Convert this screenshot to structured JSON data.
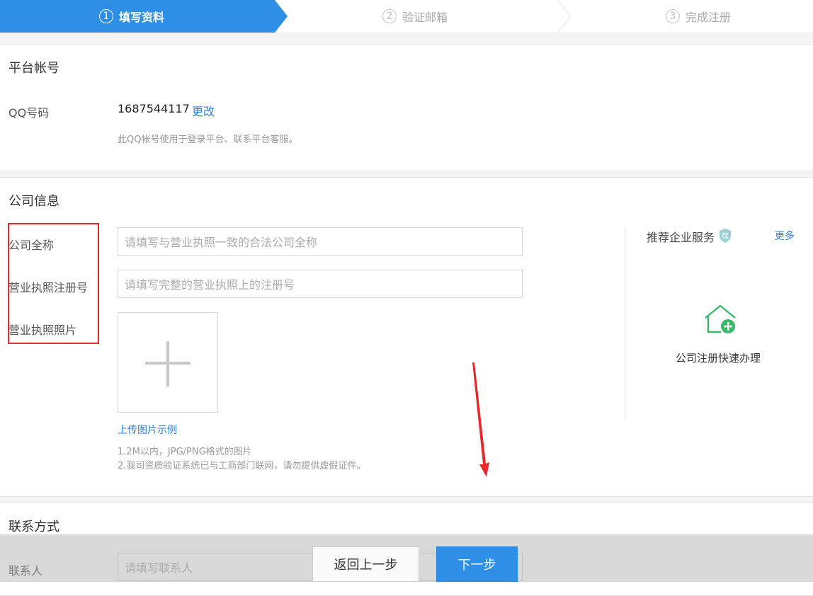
{
  "steps": [
    {
      "num": "1",
      "label": "填写资料",
      "active": true
    },
    {
      "num": "2",
      "label": "验证邮箱",
      "active": false
    },
    {
      "num": "3",
      "label": "完成注册",
      "active": false
    }
  ],
  "platform": {
    "title": "平台帐号",
    "qq_label": "QQ号码",
    "qq_value": "1687544117",
    "change_link": "更改",
    "qq_hint": "此QQ帐号使用于登录平台、联系平台客服。"
  },
  "company": {
    "title": "公司信息",
    "name_label": "公司全称",
    "name_placeholder": "请填写与营业执照一致的合法公司全称",
    "reg_label": "营业执照注册号",
    "reg_placeholder": "请填写完整的营业执照上的注册号",
    "photo_label": "营业执照照片",
    "upload_example": "上传图片示例",
    "hint1": "1.2M以内，JPG/PNG格式的图片",
    "hint2": "2.我司资质验证系统已与工商部门联网，请勿提供虚假证件。"
  },
  "side": {
    "title": "推荐企业服务",
    "more": "更多",
    "service_label": "公司注册快速办理",
    "icon": "house-plus-icon",
    "badge_icon": "shield-badge-icon"
  },
  "contact": {
    "title": "联系方式",
    "person_label": "联系人",
    "person_placeholder": "请填写联系人"
  },
  "buttons": {
    "back": "返回上一步",
    "next": "下一步"
  },
  "colors": {
    "accent": "#2f8ee5",
    "link": "#2f7ed8",
    "highlight": "#e8282a",
    "service_green": "#3bb86a"
  }
}
